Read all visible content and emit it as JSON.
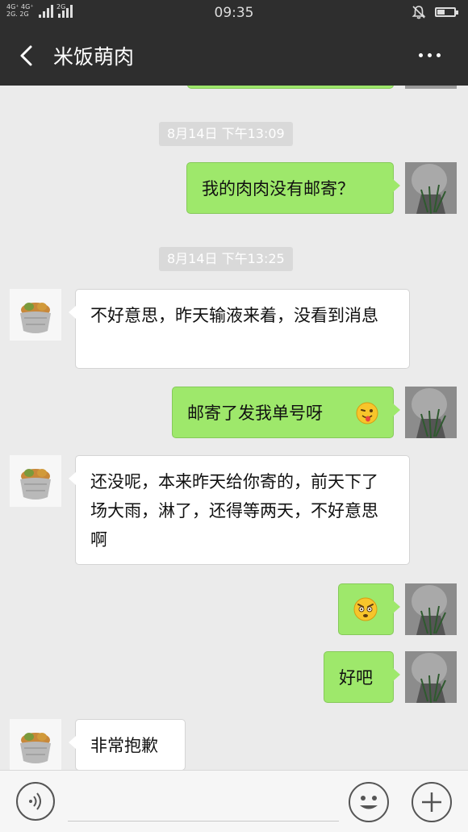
{
  "status_bar": {
    "network_top": "4G⁺ 4G⁺",
    "network_bottom": "2G. 2G",
    "label_2g": "2G",
    "time": "09:35"
  },
  "header": {
    "title": "米饭萌肉"
  },
  "messages": [
    {
      "type": "timestamp",
      "text": "8月14日 下午13:09"
    },
    {
      "type": "message",
      "sender": "me",
      "text": "我的肉肉没有邮寄？"
    },
    {
      "type": "timestamp",
      "text": "8月14日 下午13:25"
    },
    {
      "type": "message",
      "sender": "them",
      "text": "不好意思，昨天输液来着，没看到消息"
    },
    {
      "type": "message",
      "sender": "me",
      "text": "邮寄了发我单号呀",
      "emoji": "wink-tongue"
    },
    {
      "type": "message",
      "sender": "them",
      "text": "还没呢，本来昨天给你寄的，前天下了场大雨，淋了，还得等两天，不好意思啊"
    },
    {
      "type": "message",
      "sender": "me",
      "text": "",
      "emoji": "annoyed"
    },
    {
      "type": "message",
      "sender": "me",
      "text": "好吧"
    },
    {
      "type": "message",
      "sender": "them",
      "text": "非常抱歉"
    }
  ],
  "input_bar": {
    "text": ""
  },
  "colors": {
    "header_bg": "#2e2e2e",
    "chat_bg": "#ebebeb",
    "my_bubble": "#9ee86b",
    "their_bubble": "#ffffff"
  },
  "icons": [
    "back-arrow-icon",
    "more-icon",
    "voice-icon",
    "emoji-icon",
    "plus-icon",
    "bell-muted-icon",
    "battery-icon",
    "signal-icon"
  ]
}
